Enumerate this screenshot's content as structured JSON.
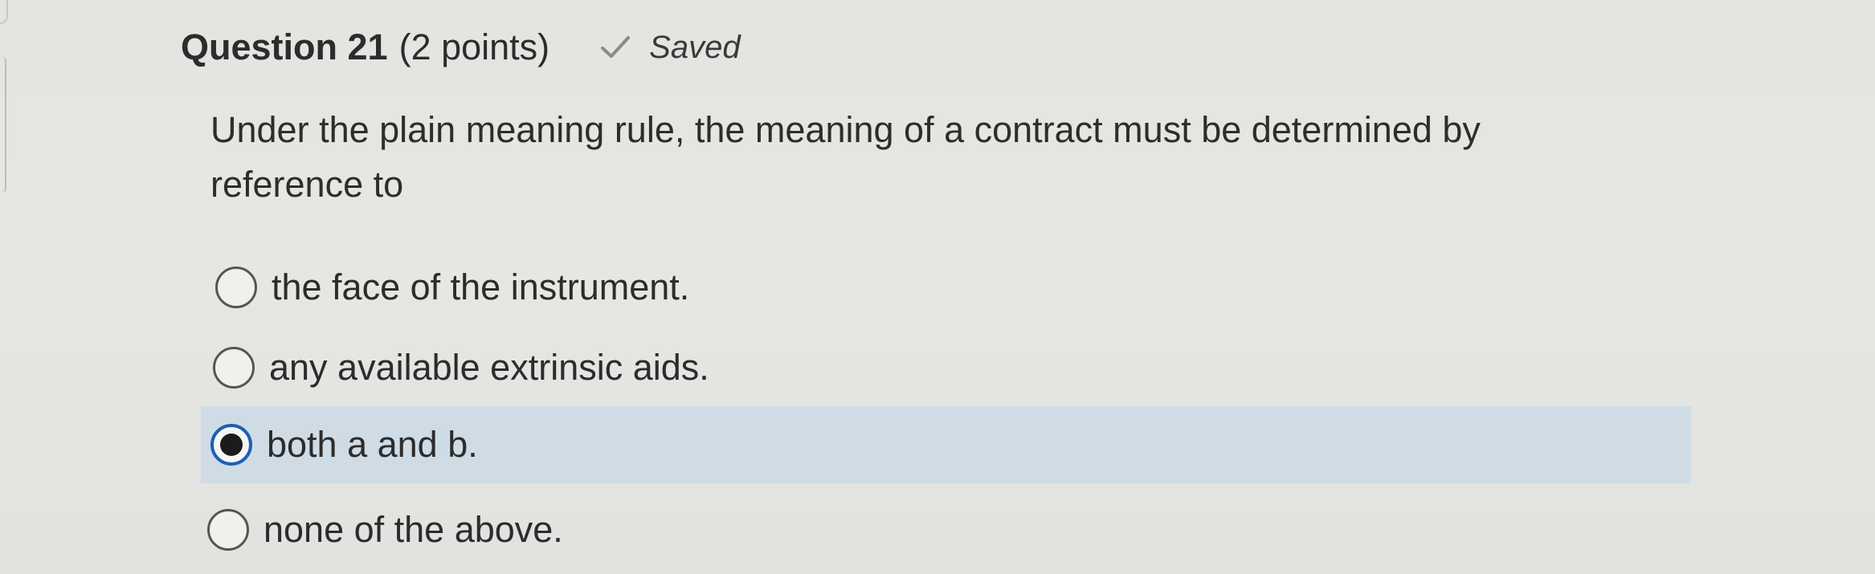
{
  "question": {
    "title": "Question 21",
    "points": "(2 points)",
    "status_icon": "checkmark-icon",
    "status": "Saved",
    "prompt": "Under the plain meaning rule, the meaning of a contract must be determined by reference to"
  },
  "options": [
    {
      "label": "the face of the instrument.",
      "selected": false
    },
    {
      "label": "any available extrinsic aids.",
      "selected": false
    },
    {
      "label": "both a and b.",
      "selected": true
    },
    {
      "label": "none of the above.",
      "selected": false
    }
  ],
  "colors": {
    "selected_row": "#cfdce6",
    "radio_selected_ring": "#1f5fb4"
  }
}
